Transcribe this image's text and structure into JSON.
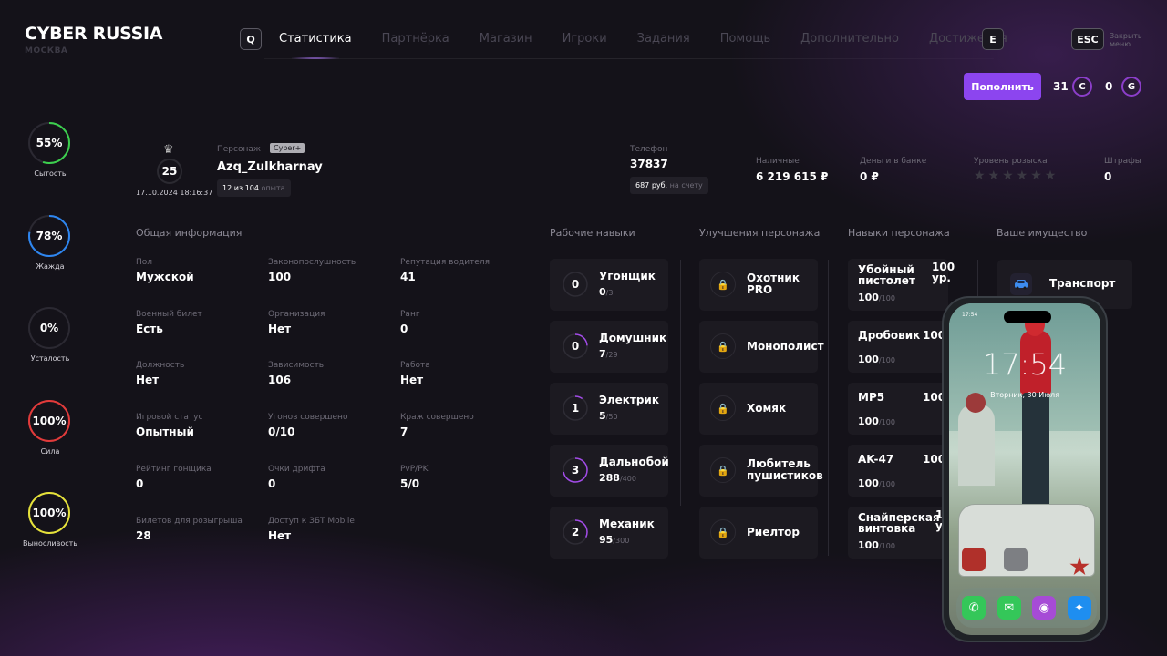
{
  "header": {
    "logo_title": "CYBER RUSSIA",
    "logo_subtitle": "МОСКВА",
    "key_left": "Q",
    "key_right": "E",
    "nav": [
      "Статистика",
      "Партнёрка",
      "Магазин",
      "Игроки",
      "Задания",
      "Помощь",
      "Дополнительно",
      "Достижения"
    ],
    "active_nav": "Статистика",
    "esc_key": "ESC",
    "esc_label_line1": "Закрыть",
    "esc_label_line2": "меню",
    "topup_label": "Пополнить",
    "coins_c_value": "31",
    "coins_c_letter": "C",
    "coins_g_value": "0",
    "coins_g_letter": "G"
  },
  "vitals": [
    {
      "value": "55%",
      "label": "Сытость",
      "percent": 55,
      "color": "#3ccf4e"
    },
    {
      "value": "78%",
      "label": "Жажда",
      "percent": 78,
      "color": "#2e86f0"
    },
    {
      "value": "0%",
      "label": "Усталость",
      "percent": 0,
      "color": "#7a7885"
    },
    {
      "value": "100%",
      "label": "Сила",
      "percent": 100,
      "color": "#e23a3a"
    },
    {
      "value": "100%",
      "label": "Выносливость",
      "percent": 100,
      "color": "#e6e23a"
    }
  ],
  "profile": {
    "level": "25",
    "datetime": "17.10.2024 18:16:37",
    "character_label": "Персонаж",
    "badge": "Cyber+",
    "name": "Azq_Zulkharnay",
    "exp_value": "12 из 104",
    "exp_label": "опыта",
    "phone_label": "Телефон",
    "phone_value": "37837",
    "phone_balance": "687 руб.",
    "phone_balance_label": "на счету",
    "cash_label": "Наличные",
    "cash_value": "6 219 615 ₽",
    "bank_label": "Деньги в банке",
    "bank_value": "0 ₽",
    "wanted_label": "Уровень розыска",
    "wanted_stars": "★★★★★★",
    "wanted_level": 0,
    "fines_label": "Штрафы",
    "fines_value": "0"
  },
  "general": {
    "title": "Общая информация",
    "items": [
      {
        "label": "Пол",
        "value": "Мужской"
      },
      {
        "label": "Законопослушность",
        "value": "100"
      },
      {
        "label": "Репутация водителя",
        "value": "41"
      },
      {
        "label": "Военный билет",
        "value": "Есть"
      },
      {
        "label": "Организация",
        "value": "Нет"
      },
      {
        "label": "Ранг",
        "value": "0"
      },
      {
        "label": "Должность",
        "value": "Нет"
      },
      {
        "label": "Зависимость",
        "value": "106"
      },
      {
        "label": "Работа",
        "value": "Нет"
      },
      {
        "label": "Игровой статус",
        "value": "Опытный"
      },
      {
        "label": "Угонов совершено",
        "value": "0/10"
      },
      {
        "label": "Краж совершено",
        "value": "7"
      },
      {
        "label": "Рейтинг гонщика",
        "value": "0"
      },
      {
        "label": "Очки дрифта",
        "value": "0"
      },
      {
        "label": "PvP/PK",
        "value": "5/0"
      },
      {
        "label": "Билетов для розыгрыша",
        "value": "28"
      },
      {
        "label": "Доступ к ЗБТ Mobile",
        "value": "Нет"
      }
    ]
  },
  "work_skills": {
    "title": "Рабочие навыки",
    "items": [
      {
        "level": "0",
        "name": "Угонщик",
        "current": "0",
        "max": "/3",
        "progress": 0
      },
      {
        "level": "0",
        "name": "Домушник",
        "current": "7",
        "max": "/29",
        "progress": 0.24
      },
      {
        "level": "1",
        "name": "Электрик",
        "current": "5",
        "max": "/50",
        "progress": 0.1
      },
      {
        "level": "3",
        "name": "Дальнобой",
        "current": "288",
        "max": "/400",
        "progress": 0.72
      },
      {
        "level": "2",
        "name": "Механик",
        "current": "95",
        "max": "/300",
        "progress": 0.32
      }
    ]
  },
  "upgrades": {
    "title": "Улучшения персонажа",
    "items": [
      {
        "line1": "Охотник",
        "line2": "PRO"
      },
      {
        "line1": "Монополист",
        "line2": ""
      },
      {
        "line1": "Хомяк",
        "line2": ""
      },
      {
        "line1": "Любитель",
        "line2": "пушистиков"
      },
      {
        "line1": "Риелтор",
        "line2": ""
      }
    ]
  },
  "char_skills": {
    "title": "Навыки персонажа",
    "items": [
      {
        "line1": "Убойный",
        "line2": "пистолет",
        "extra1": "100",
        "extra2": "ур.",
        "current": "100",
        "max": "/100"
      },
      {
        "line1": "Дробовик",
        "line2": "",
        "extra1": "100",
        "extra2": "",
        "current": "100",
        "max": "/100"
      },
      {
        "line1": "MP5",
        "line2": "",
        "extra1": "100",
        "extra2": "",
        "current": "100",
        "max": "/100"
      },
      {
        "line1": "AK-47",
        "line2": "",
        "extra1": "100",
        "extra2": "",
        "current": "100",
        "max": "/100"
      },
      {
        "line1": "Снайперская",
        "line2": "винтовка",
        "extra1": "1",
        "extra2": "у",
        "current": "100",
        "max": "/100"
      }
    ]
  },
  "property": {
    "title": "Ваше имущество",
    "transport_label": "Транспорт"
  },
  "phone": {
    "status_time": "17:54",
    "time": "17:54",
    "date": "Вторник, 30 Июля"
  }
}
